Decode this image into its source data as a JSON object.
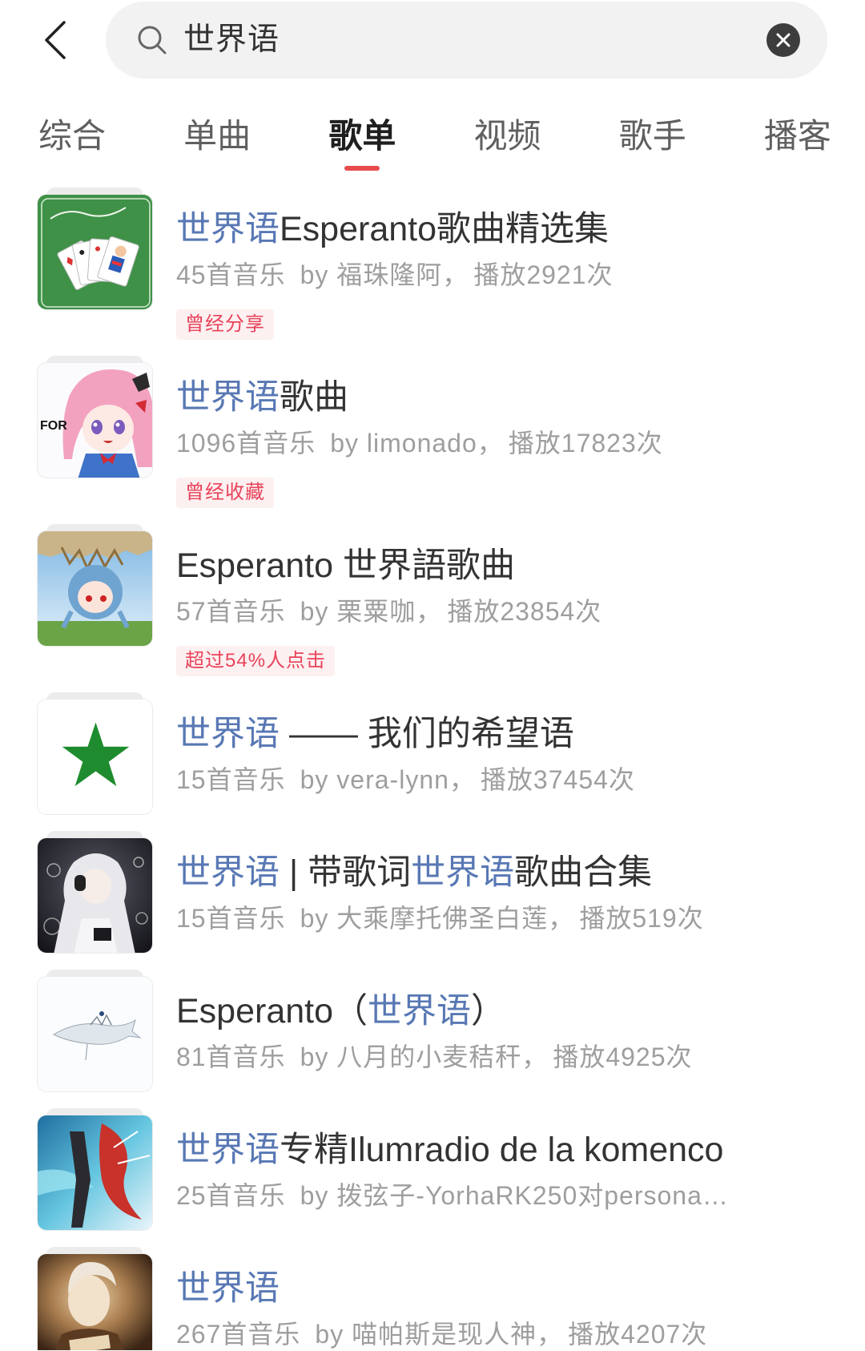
{
  "search": {
    "query": "世界语"
  },
  "icons": {
    "back": "chevron-left-icon",
    "search": "search-icon",
    "clear": "close-circle-icon"
  },
  "colors": {
    "keyword_highlight": "#5878b4",
    "title_text": "#333333",
    "meta_text": "#9e9e9e",
    "tag_text": "#e8435a",
    "tag_background": "#fdf0f1",
    "tab_indicator": "#e84c4c",
    "search_background": "#f2f2f2"
  },
  "tabs": [
    {
      "label": "综合",
      "active": false
    },
    {
      "label": "单曲",
      "active": false
    },
    {
      "label": "歌单",
      "active": true
    },
    {
      "label": "视频",
      "active": false
    },
    {
      "label": "歌手",
      "active": false
    },
    {
      "label": "播客",
      "active": false
    }
  ],
  "playlists": [
    {
      "title": [
        {
          "text": "世界语",
          "highlight": true
        },
        {
          "text": "Esperanto歌曲精选集",
          "highlight": false
        }
      ],
      "track_count": "45首音乐",
      "creator": "by 福珠隆阿，",
      "plays": "播放2921次",
      "tag": "曾经分享"
    },
    {
      "title": [
        {
          "text": "世界语",
          "highlight": true
        },
        {
          "text": "歌曲",
          "highlight": false
        }
      ],
      "track_count": "1096首音乐",
      "creator": "by limonado，",
      "plays": "播放17823次",
      "tag": "曾经收藏",
      "cover_text": "FOR"
    },
    {
      "title": [
        {
          "text": "Esperanto 世界語歌曲",
          "highlight": false
        }
      ],
      "track_count": "57首音乐",
      "creator": "by 栗粟咖，",
      "plays": "播放23854次",
      "tag": "超过54%人点击"
    },
    {
      "title": [
        {
          "text": "世界语",
          "highlight": true
        },
        {
          "text": " —— 我们的希望语",
          "highlight": false
        }
      ],
      "track_count": "15首音乐",
      "creator": "by vera-lynn，",
      "plays": "播放37454次"
    },
    {
      "title": [
        {
          "text": "世界语",
          "highlight": true
        },
        {
          "text": " | 带歌词",
          "highlight": false
        },
        {
          "text": "世界语",
          "highlight": true
        },
        {
          "text": "歌曲合集",
          "highlight": false
        }
      ],
      "track_count": "15首音乐",
      "creator": "by 大乘摩托佛圣白莲，",
      "plays": "播放519次"
    },
    {
      "title": [
        {
          "text": "Esperanto（",
          "highlight": false
        },
        {
          "text": "世界语",
          "highlight": true
        },
        {
          "text": "）",
          "highlight": false
        }
      ],
      "track_count": "81首音乐",
      "creator": "by 八月的小麦秸秆，",
      "plays": "播放4925次"
    },
    {
      "title": [
        {
          "text": "世界语",
          "highlight": true
        },
        {
          "text": "专精Ilumradio de la komenco",
          "highlight": false
        }
      ],
      "track_count": "25首音乐",
      "creator": "by 拨弦子-YorhaRK250对persona…"
    },
    {
      "title": [
        {
          "text": "世界语",
          "highlight": true
        }
      ],
      "track_count": "267首音乐",
      "creator": "by 喵帕斯是现人神，",
      "plays": "播放4207次"
    }
  ]
}
